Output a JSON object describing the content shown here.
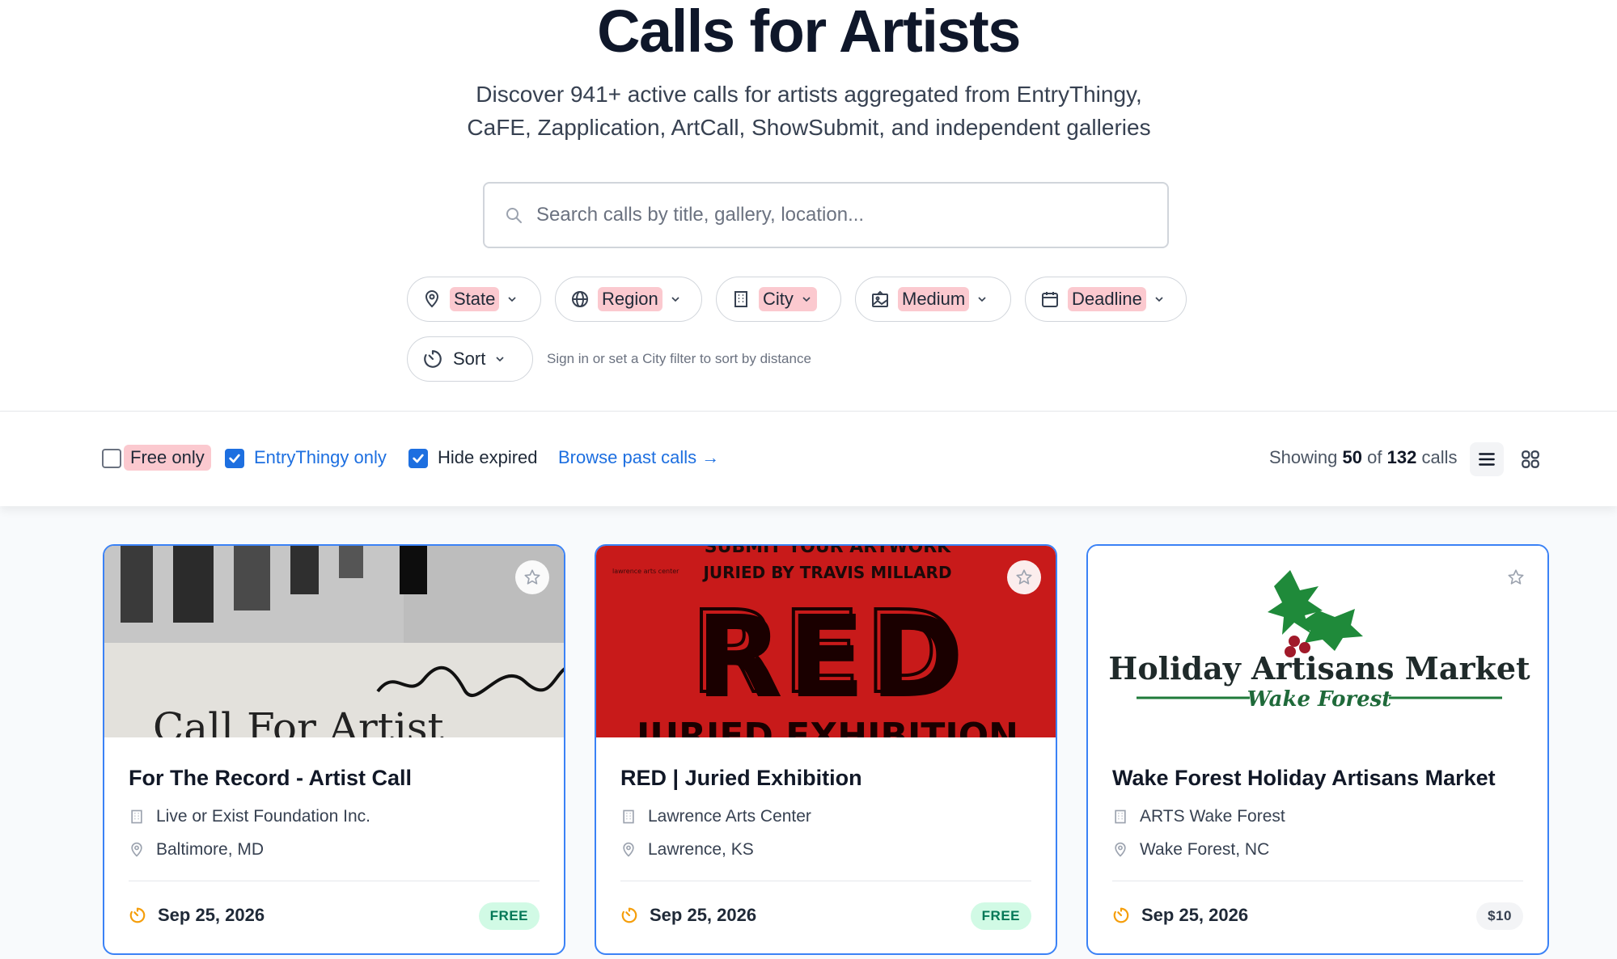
{
  "hero": {
    "title": "Calls for Artists",
    "subtitle": "Discover 941+ active calls for artists aggregated from EntryThingy, CaFE, Zapplication, ArtCall, ShowSubmit, and independent galleries"
  },
  "search": {
    "placeholder": "Search calls by title, gallery, location..."
  },
  "filters": [
    {
      "label": "State",
      "icon": "map-pin-icon"
    },
    {
      "label": "Region",
      "icon": "globe-icon"
    },
    {
      "label": "City",
      "icon": "building-icon"
    },
    {
      "label": "Medium",
      "icon": "image-icon"
    },
    {
      "label": "Deadline",
      "icon": "calendar-icon"
    }
  ],
  "sort": {
    "label": "Sort",
    "icon": "timer-icon",
    "hint": "Sign in or set a City filter to sort by distance"
  },
  "toolbar": {
    "free_only": {
      "label": "Free only",
      "checked": false
    },
    "entrythingy_only": {
      "label": "EntryThingy only",
      "checked": true
    },
    "hide_expired": {
      "label": "Hide expired",
      "checked": true
    },
    "browse_past": "Browse past calls →",
    "showing_prefix": "Showing",
    "showing_count": "50",
    "showing_of": "of",
    "showing_total": "132",
    "showing_suffix": "calls"
  },
  "colors": {
    "accent": "#1d6fe0",
    "card_border": "#3b82f6",
    "highlight": "#fbc9cf",
    "free_badge_bg": "#d1fae5",
    "deadline_icon": "#f59e0b"
  },
  "cards": [
    {
      "title": "For The Record - Artist Call",
      "organization": "Live or Exist Foundation Inc.",
      "location": "Baltimore, MD",
      "deadline": "Sep 25, 2026",
      "price": "FREE",
      "image_text": "Call For Artist"
    },
    {
      "title": "RED | Juried Exhibition",
      "organization": "Lawrence Arts Center",
      "location": "Lawrence, KS",
      "deadline": "Sep 25, 2026",
      "price": "FREE",
      "image_text": {
        "top": "SUBMIT YOUR ARTWORK",
        "juror": "JURIED BY TRAVIS MILLARD",
        "big": "RED",
        "bottom": "JURIED EXHIBITION",
        "logo": "lawrence arts center"
      }
    },
    {
      "title": "Wake Forest Holiday Artisans Market",
      "organization": "ARTS Wake Forest",
      "location": "Wake Forest, NC",
      "deadline": "Sep 25, 2026",
      "price": "$10",
      "image_text": {
        "main": "Holiday Artisans Market",
        "sub": "Wake Forest"
      }
    }
  ]
}
